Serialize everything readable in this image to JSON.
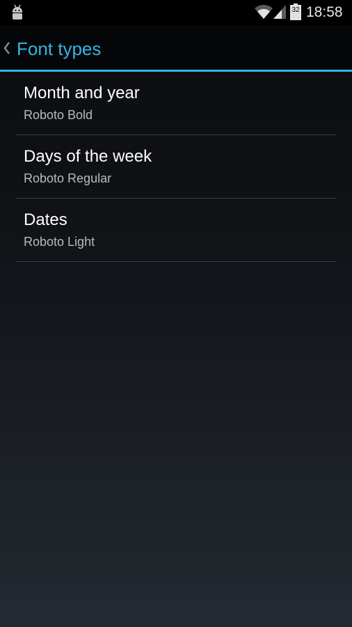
{
  "status_bar": {
    "notification_icon": "android-icon",
    "wifi_icon": "wifi-icon",
    "signal_icon": "signal-icon",
    "battery_icon": "battery-icon",
    "battery_level": "32",
    "time": "18:58"
  },
  "action_bar": {
    "up_icon": "chevron-left-icon",
    "title": "Font types",
    "accent_color": "#33b5e5"
  },
  "preferences": [
    {
      "title": "Month and year",
      "summary": "Roboto Bold"
    },
    {
      "title": "Days of the week",
      "summary": "Roboto Regular"
    },
    {
      "title": "Dates",
      "summary": "Roboto Light"
    }
  ]
}
